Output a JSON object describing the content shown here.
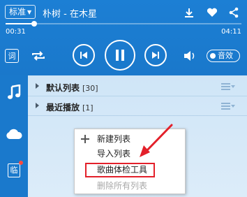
{
  "player": {
    "quality_label": "标准",
    "song_title": "朴树 - 在木星",
    "time_current": "00:31",
    "time_total": "04:11",
    "progress": 0.12,
    "lyric_btn_label": "词",
    "sound_effect_label": "音效"
  },
  "icons": {
    "download": "download-icon",
    "favorite": "heart-icon",
    "share": "share-icon",
    "repeat": "repeat-icon",
    "previous": "previous-icon",
    "pause": "pause-icon",
    "next": "next-icon",
    "volume": "volume-icon"
  },
  "sidebar": {
    "items": [
      {
        "name": "music-note-icon"
      },
      {
        "name": "cloud-icon"
      },
      {
        "name": "temp-list-icon",
        "label": "临"
      }
    ]
  },
  "playlists": [
    {
      "name": "默认列表",
      "count": "[30]"
    },
    {
      "name": "最近播放",
      "count": "[1]"
    }
  ],
  "context_menu": {
    "items": [
      {
        "label": "新建列表",
        "enabled": true
      },
      {
        "label": "导入列表",
        "enabled": true
      },
      {
        "label": "歌曲体检工具",
        "enabled": true,
        "highlighted": true
      },
      {
        "label": "删除所有列表",
        "enabled": false
      }
    ]
  },
  "colors": {
    "brand_blue": "#1c7fd4",
    "pane_bg": "#cfe5f7",
    "annotation_red": "#e3202a"
  }
}
